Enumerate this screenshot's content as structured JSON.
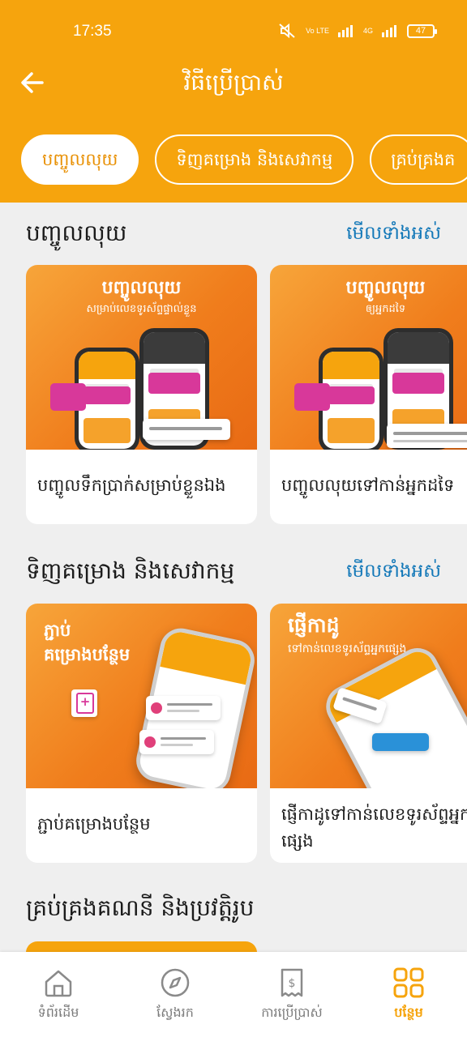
{
  "status_bar": {
    "time": "17:35",
    "battery": "47",
    "network_label": "Vo LTE",
    "signal_label": "4G"
  },
  "header": {
    "title": "វិធីប្រើប្រាស់"
  },
  "chips": [
    {
      "label": "បញ្ចូលលុយ",
      "active": true
    },
    {
      "label": "ទិញគម្រោង និងសេវាកម្ម",
      "active": false
    },
    {
      "label": "គ្រប់គ្រងគ",
      "active": false
    }
  ],
  "sections": [
    {
      "title": "បញ្ចូលលុយ",
      "see_all": "មើលទាំងអស់",
      "cards": [
        {
          "label": "បញ្ចូលទឹកប្រាក់សម្រាប់ខ្លួនឯង",
          "image_title": "បញ្ចូលលុយ",
          "image_subtitle": "សម្រាប់លេខទូរស័ព្ទផ្ទាល់ខ្លួន"
        },
        {
          "label": "បញ្ចូលលុយទៅកាន់អ្នកដទៃ",
          "image_title": "បញ្ចូលលុយ",
          "image_subtitle": "ឲ្យអ្នកដទៃ"
        }
      ]
    },
    {
      "title": "ទិញគម្រោង និងសេវាកម្ម",
      "see_all": "មើលទាំងអស់",
      "cards": [
        {
          "label": "ភ្ជាប់គម្រោងបន្ថែម",
          "image_title": "ភ្ជាប់",
          "image_subtitle": "គម្រោងបន្ថែម"
        },
        {
          "label": "ផ្ញើកាដូទៅកាន់លេខទូរស័ព្ទអ្នកផ្សេង",
          "image_title": "ផ្ញើកាដូ",
          "image_subtitle": "ទៅកាន់លេខទូរស័ព្ទអ្នកផ្សេង"
        }
      ]
    },
    {
      "title": "គ្រប់គ្រងគណនី និងប្រវត្តិរូប"
    }
  ],
  "bottom_nav": [
    {
      "label": "ទំព័រដើម",
      "icon": "home-icon",
      "active": false
    },
    {
      "label": "ស្វែងរក",
      "icon": "compass-icon",
      "active": false
    },
    {
      "label": "ការប្រើប្រាស់",
      "icon": "receipt-icon",
      "active": false
    },
    {
      "label": "បន្ថែម",
      "icon": "grid-icon",
      "active": true
    }
  ],
  "colors": {
    "brand": "#f6a40d",
    "link": "#1378b8",
    "background": "#efefef"
  }
}
